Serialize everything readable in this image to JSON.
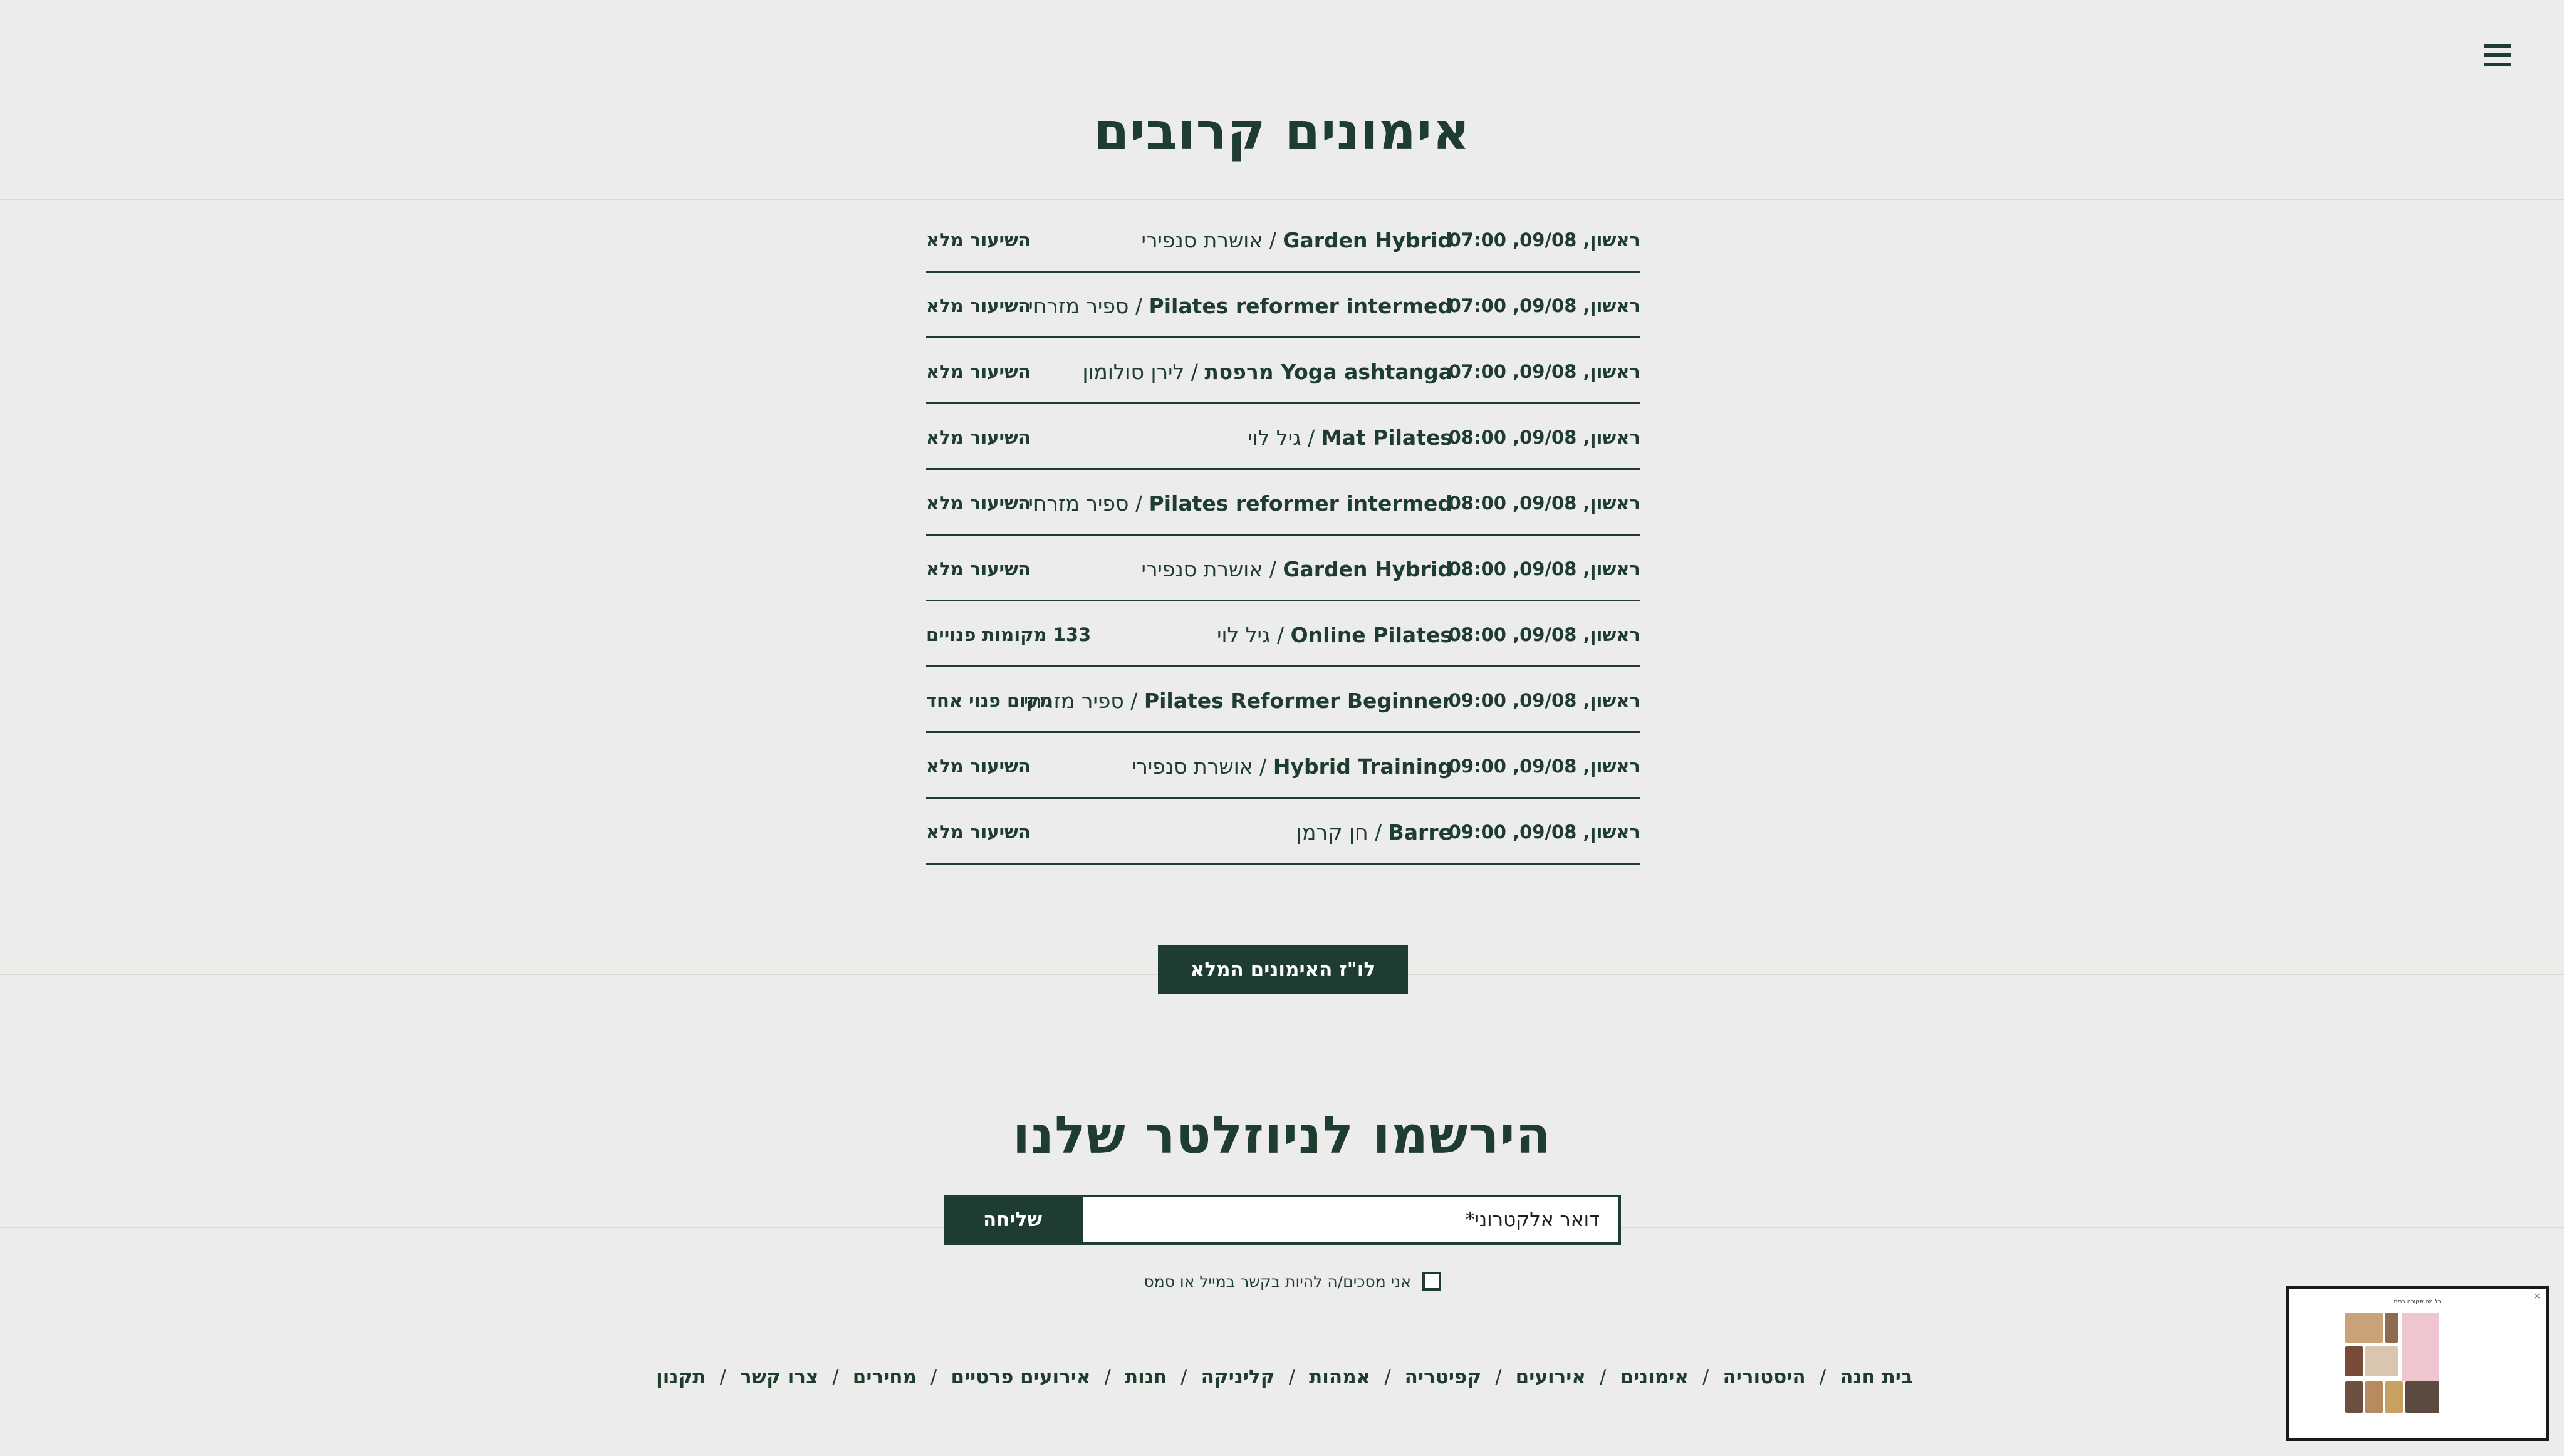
{
  "header": {
    "menu_icon": "hamburger-menu-icon"
  },
  "classes_section": {
    "title": "אימונים קרובים",
    "rows": [
      {
        "when": "ראשון, 09/08, 07:00",
        "name": "Garden Hybrid",
        "trainer": " / אושרת סנפירי",
        "status": "השיעור מלא"
      },
      {
        "when": "ראשון, 09/08, 07:00",
        "name": "Pilates reformer intermed",
        "trainer": " / ספיר מזרחי",
        "status": "השיעור מלא"
      },
      {
        "when": "ראשון, 09/08, 07:00",
        "name": "Yoga ashtanga מרפסת",
        "trainer": " / לירן סולומון",
        "status": "השיעור מלא"
      },
      {
        "when": "ראשון, 09/08, 08:00",
        "name": "Mat Pilates",
        "trainer": " / גיל לוי",
        "status": "השיעור מלא"
      },
      {
        "when": "ראשון, 09/08, 08:00",
        "name": "Pilates reformer intermed",
        "trainer": " / ספיר מזרחי",
        "status": "השיעור מלא"
      },
      {
        "when": "ראשון, 09/08, 08:00",
        "name": "Garden Hybrid",
        "trainer": " / אושרת סנפירי",
        "status": "השיעור מלא"
      },
      {
        "when": "ראשון, 09/08, 08:00",
        "name": "Online Pilates",
        "trainer": " / גיל לוי",
        "status": "133 מקומות פנויים"
      },
      {
        "when": "ראשון, 09/08, 09:00",
        "name": "Pilates Reformer Beginner",
        "trainer": " / ספיר מזרחי",
        "status": "מקום פנוי אחד"
      },
      {
        "when": "ראשון, 09/08, 09:00",
        "name": "Hybrid Training",
        "trainer": " / אושרת סנפירי",
        "status": "השיעור מלא"
      },
      {
        "when": "ראשון, 09/08, 09:00",
        "name": "Barre",
        "trainer": " / חן קרמן",
        "status": "השיעור מלא"
      }
    ],
    "full_schedule_button": "לו\"ז האימונים המלא"
  },
  "newsletter": {
    "title": "הירשמו לניוזלטר שלנו",
    "email_placeholder": "דואר אלקטרוני*",
    "submit_label": "שליחה",
    "consent_label": "אני מסכים/ה להיות בקשר במייל או סמס"
  },
  "footer_nav": {
    "links": [
      "בית חנה",
      "היסטוריה",
      "אימונים",
      "אירועים",
      "קפיטריה",
      "אמהות",
      "קליניקה",
      "חנות",
      "אירועים פרטיים",
      "מחירים",
      "צרו קשר",
      "תקנון"
    ],
    "separator": "/"
  },
  "preview_widget": {
    "title": "כל מה שקורה בבית",
    "close_icon": "close-icon"
  },
  "colors": {
    "primary": "#1e3d30",
    "background": "#ececea",
    "white": "#ffffff"
  }
}
